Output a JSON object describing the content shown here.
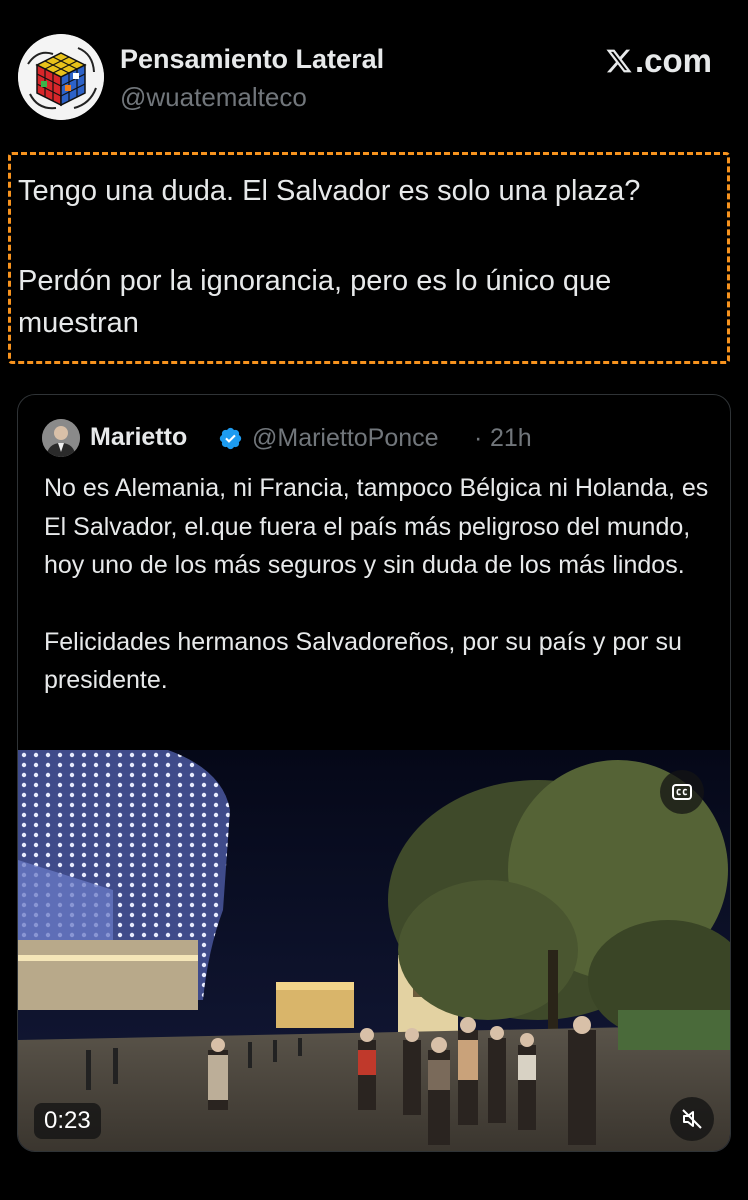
{
  "author": {
    "name": "Pensamiento Lateral",
    "handle": "@wuatemalteco"
  },
  "brand": {
    "label": ".com",
    "icon": "x-logo-icon"
  },
  "tweet": {
    "line1": "Tengo una duda. El Salvador es solo una plaza?",
    "line2": "Perdón por la ignorancia, pero es lo único que muestran",
    "highlight_color": "#f7931e"
  },
  "quote": {
    "name": "Marietto",
    "verified_icon": "verified-badge-icon",
    "handle": "@MariettoPonce",
    "separator": "·",
    "time": "21h",
    "para1": "No es Alemania, ni Francia, tampoco Bélgica ni Holanda, es El Salvador, el.que fuera el país más peligroso del mundo, hoy uno de los más seguros y sin duda de los más lindos.",
    "para2": "Felicidades hermanos Salvadoreños, por su país y por su presidente."
  },
  "video": {
    "duration": "0:23",
    "cc_icon": "closed-captions-icon",
    "mute_icon": "muted-speaker-icon"
  },
  "colors": {
    "background": "#000000",
    "text": "#e7e9ea",
    "secondary": "#71767b",
    "verified": "#1d9bf0",
    "border": "#2f3336"
  }
}
